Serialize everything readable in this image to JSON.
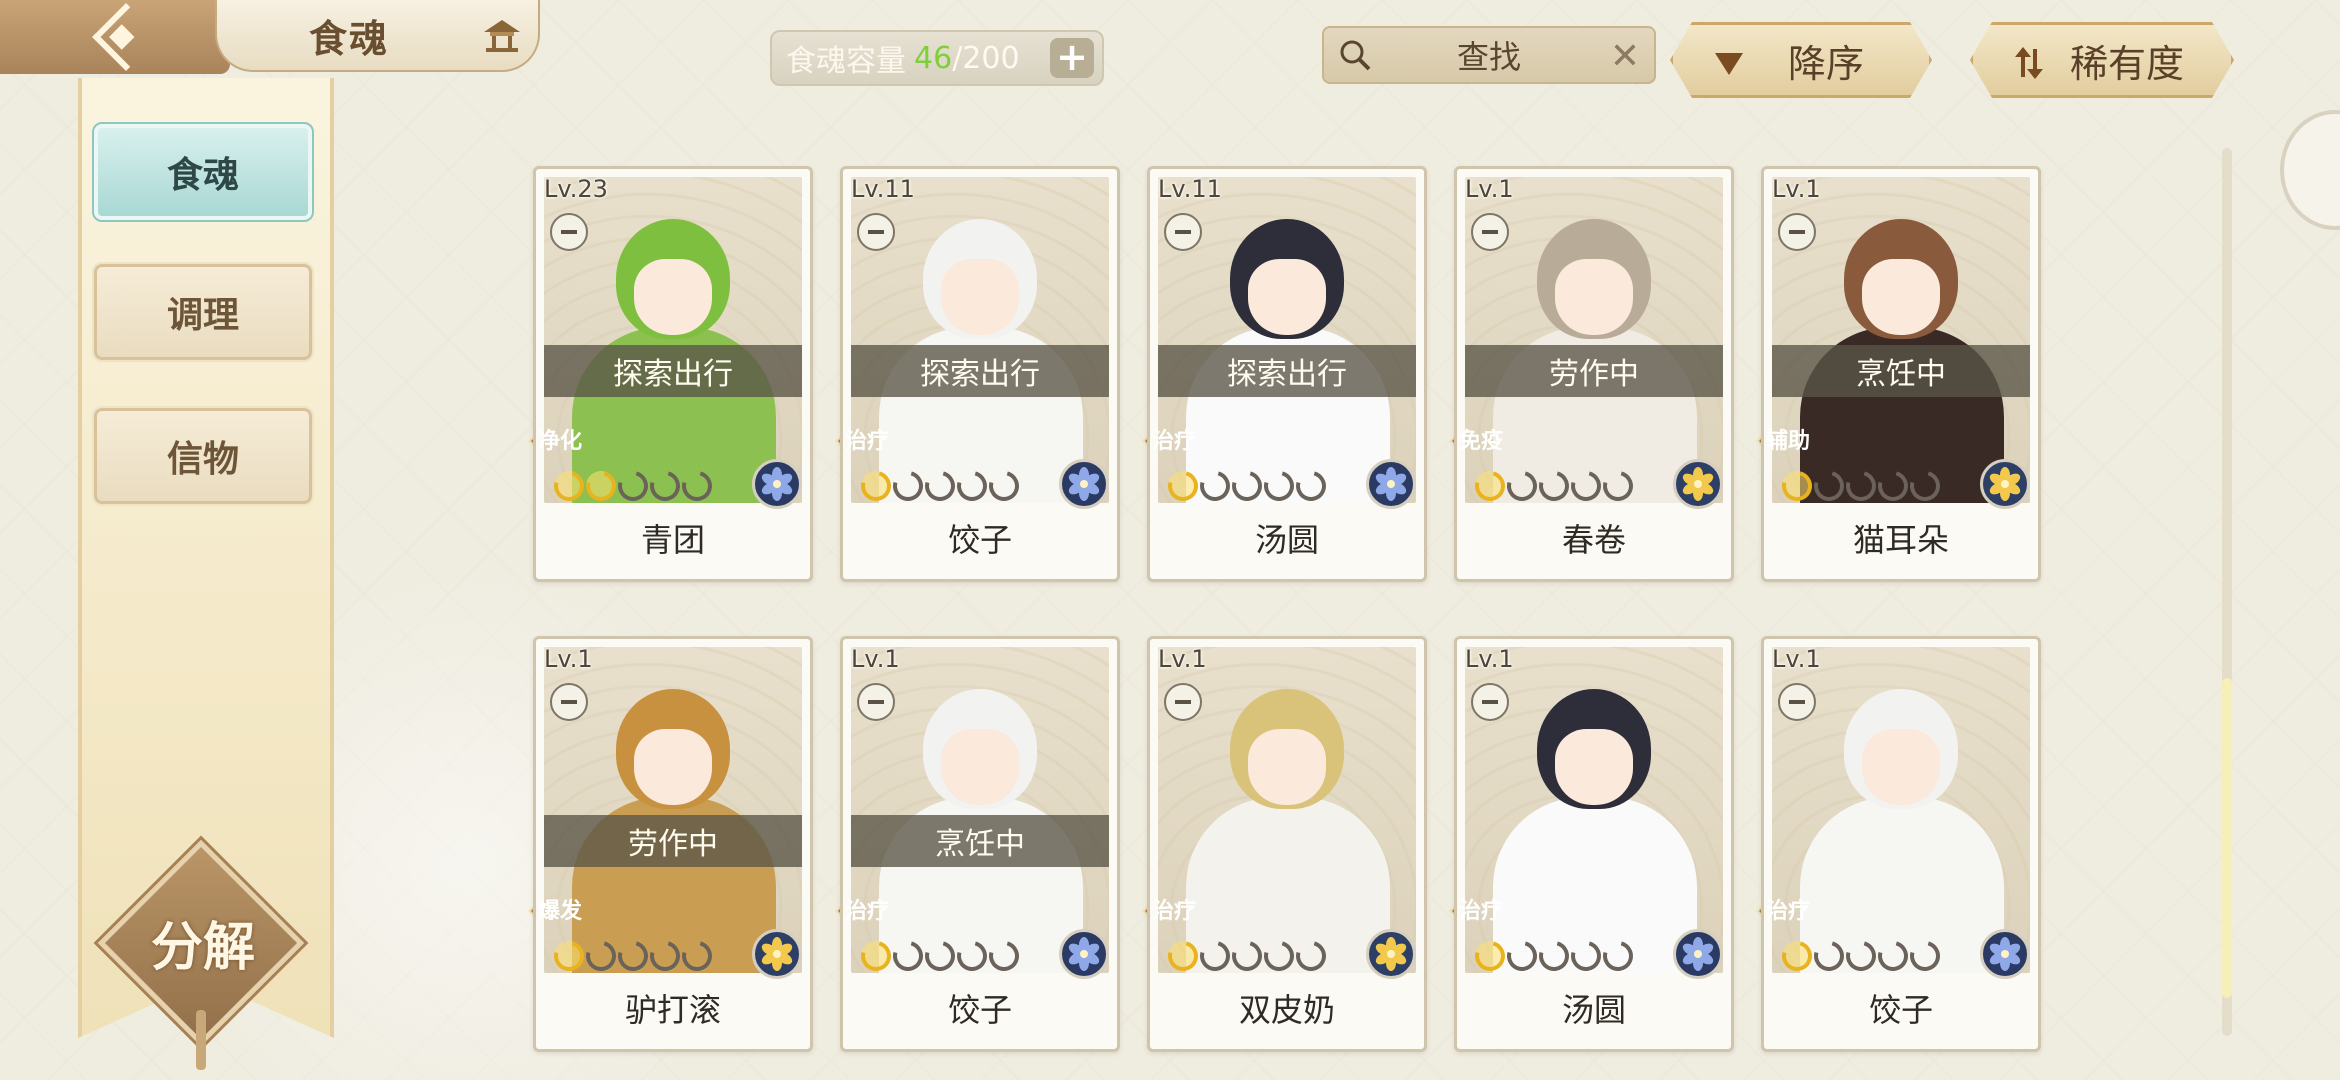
{
  "header": {
    "title": "食魂",
    "capacity": {
      "label": "食魂容量",
      "current": "46",
      "max": "/200",
      "plus": "+"
    },
    "search": {
      "placeholder": "查找",
      "clear": "✕"
    },
    "sort_desc_label": "降序",
    "sort_rarity_label": "稀有度"
  },
  "sidebar": {
    "tabs": [
      {
        "label": "食魂",
        "active": true
      },
      {
        "label": "调理",
        "active": false
      },
      {
        "label": "信物",
        "active": false
      }
    ],
    "decompose_label": "分解"
  },
  "colors": {
    "accent_teal": "#a9d8d4",
    "gold": "#c9a86a",
    "capacity_current": "#7fcf3d"
  },
  "cards": [
    {
      "level": "Lv.23",
      "status": "探索出行",
      "role": "净化",
      "stars_on": 2,
      "stars_total": 5,
      "element": "blue-flower",
      "name": "青团"
    },
    {
      "level": "Lv.11",
      "status": "探索出行",
      "role": "治疗",
      "stars_on": 1,
      "stars_total": 5,
      "element": "blue-flower",
      "name": "饺子"
    },
    {
      "level": "Lv.11",
      "status": "探索出行",
      "role": "治疗",
      "stars_on": 1,
      "stars_total": 5,
      "element": "blue-flower",
      "name": "汤圆"
    },
    {
      "level": "Lv.1",
      "status": "劳作中",
      "role": "免疫",
      "stars_on": 1,
      "stars_total": 5,
      "element": "gold-flower",
      "name": "春卷"
    },
    {
      "level": "Lv.1",
      "status": "烹饪中",
      "role": "辅助",
      "stars_on": 1,
      "stars_total": 5,
      "element": "gold-flower",
      "name": "猫耳朵"
    },
    {
      "level": "Lv.1",
      "status": "劳作中",
      "role": "爆发",
      "stars_on": 1,
      "stars_total": 5,
      "element": "gold-flower",
      "name": "驴打滚"
    },
    {
      "level": "Lv.1",
      "status": "烹饪中",
      "role": "治疗",
      "stars_on": 1,
      "stars_total": 5,
      "element": "blue-flower",
      "name": "饺子"
    },
    {
      "level": "Lv.1",
      "status": "",
      "role": "治疗",
      "stars_on": 1,
      "stars_total": 5,
      "element": "gold-flower",
      "name": "双皮奶"
    },
    {
      "level": "Lv.1",
      "status": "",
      "role": "治疗",
      "stars_on": 1,
      "stars_total": 5,
      "element": "blue-flower",
      "name": "汤圆"
    },
    {
      "level": "Lv.1",
      "status": "",
      "role": "治疗",
      "stars_on": 1,
      "stars_total": 5,
      "element": "blue-flower",
      "name": "饺子"
    }
  ]
}
